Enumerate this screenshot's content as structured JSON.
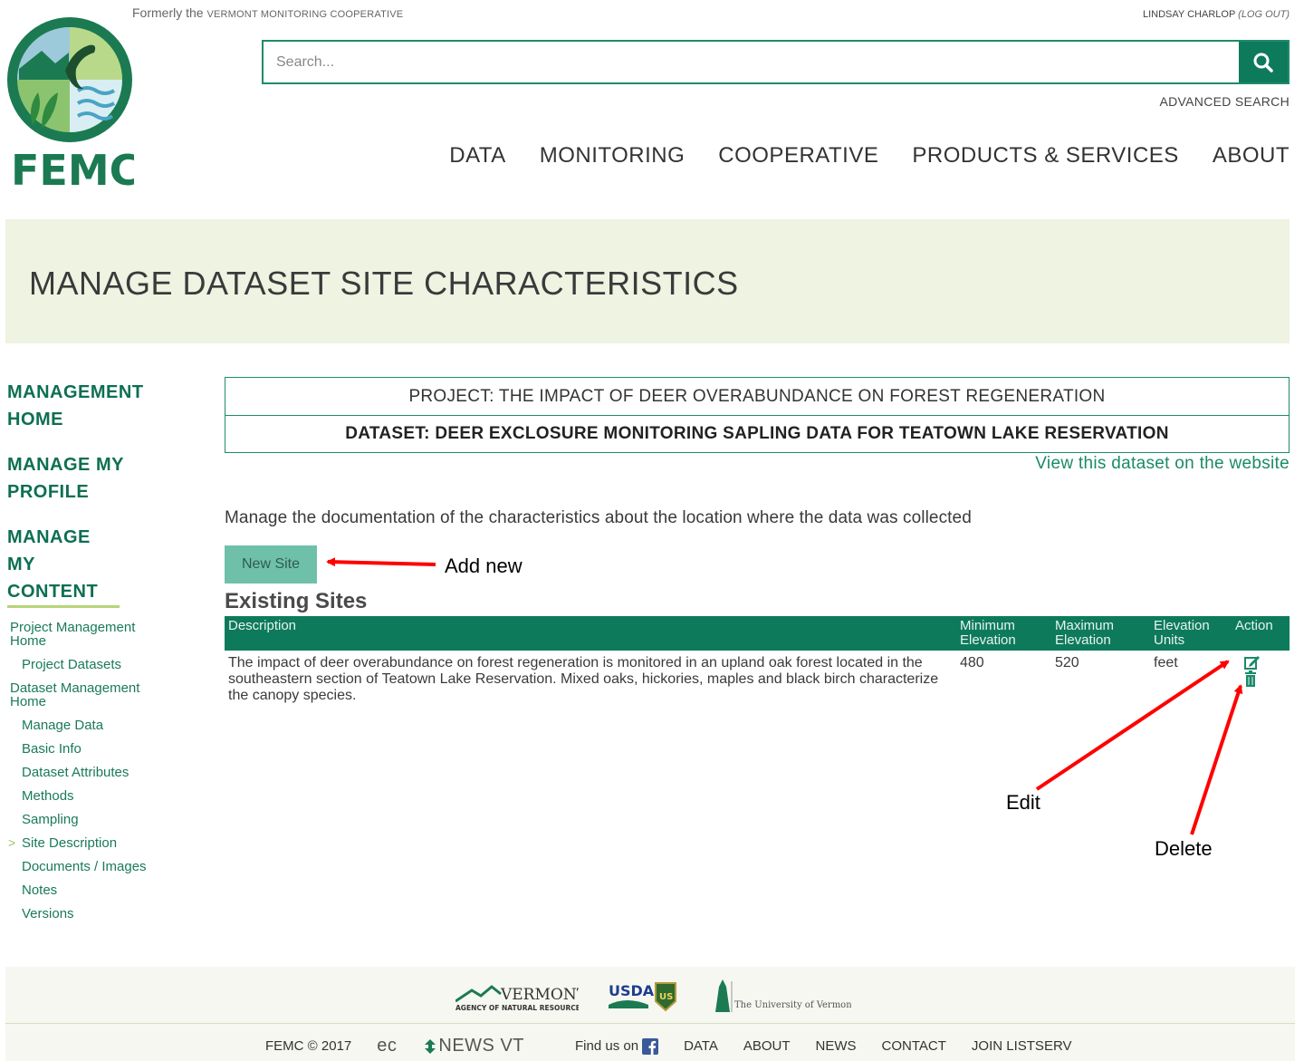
{
  "header": {
    "formerly_prefix": "Formerly the",
    "formerly_name": "VERMONT MONITORING COOPERATIVE",
    "user_name": "LINDSAY CHARLOP",
    "logout_label": "(LOG OUT)",
    "logo_text": "FEMC",
    "search_placeholder": "Search...",
    "advanced_search": "ADVANCED SEARCH"
  },
  "nav": [
    "DATA",
    "MONITORING",
    "COOPERATIVE",
    "PRODUCTS & SERVICES",
    "ABOUT"
  ],
  "page_title": "MANAGE DATASET SITE CHARACTERISTICS",
  "sidebar": {
    "management_home": "MANAGEMENT HOME",
    "manage_profile": "MANAGE MY PROFILE",
    "manage_content": "MANAGE MY CONTENT",
    "items": [
      {
        "label": "Project Management Home",
        "level": 1
      },
      {
        "label": "Project Datasets",
        "level": 2
      },
      {
        "label": "Dataset Management Home",
        "level": 1
      },
      {
        "label": "Manage Data",
        "level": 2
      },
      {
        "label": "Basic Info",
        "level": 2
      },
      {
        "label": "Dataset Attributes",
        "level": 2
      },
      {
        "label": "Methods",
        "level": 2
      },
      {
        "label": "Sampling",
        "level": 2
      },
      {
        "label": "Site Description",
        "level": 2,
        "current": true
      },
      {
        "label": "Documents / Images",
        "level": 2
      },
      {
        "label": "Notes",
        "level": 2
      },
      {
        "label": "Versions",
        "level": 2
      }
    ]
  },
  "content": {
    "project_label": "PROJECT: THE IMPACT OF DEER OVERABUNDANCE ON FOREST REGENERATION",
    "dataset_label": "DATASET: DEER EXCLOSURE MONITORING SAPLING DATA FOR TEATOWN LAKE RESERVATION",
    "view_link": "View this dataset on the website",
    "intro": "Manage the documentation of the characteristics about the location where the data was collected",
    "new_site_button": "New Site",
    "existing_heading": "Existing Sites",
    "table": {
      "headers": [
        "Description",
        "Minimum Elevation",
        "Maximum Elevation",
        "Elevation Units",
        "Action"
      ],
      "rows": [
        {
          "description": "The impact of deer overabundance on forest regeneration is monitored in an upland oak forest located in the southeastern section of Teatown Lake Reservation. Mixed oaks, hickories, maples and black birch characterize the canopy species.",
          "min_elevation": "480",
          "max_elevation": "520",
          "units": "feet"
        }
      ]
    }
  },
  "annotations": {
    "add_new": "Add new",
    "edit": "Edit",
    "delete": "Delete",
    "arrow_color": "#ff0000"
  },
  "footer": {
    "logo_vermont": "VERMONT",
    "logo_vermont_sub": "AGENCY OF NATURAL RESOURCES",
    "logo_usda": "USDA",
    "logo_us": "US",
    "logo_uvm": "The University of Vermont",
    "copyright": "FEMC © 2017",
    "ecnews": "ec",
    "ecnews_rest": "NEWS VT",
    "find_us": "Find us on",
    "links": [
      "DATA",
      "ABOUT",
      "NEWS",
      "CONTACT",
      "JOIN LISTSERV"
    ]
  },
  "colors": {
    "brand_green": "#0e7a5c",
    "light_green_banner": "#eef3e2",
    "button_teal": "#6ec1a8"
  }
}
